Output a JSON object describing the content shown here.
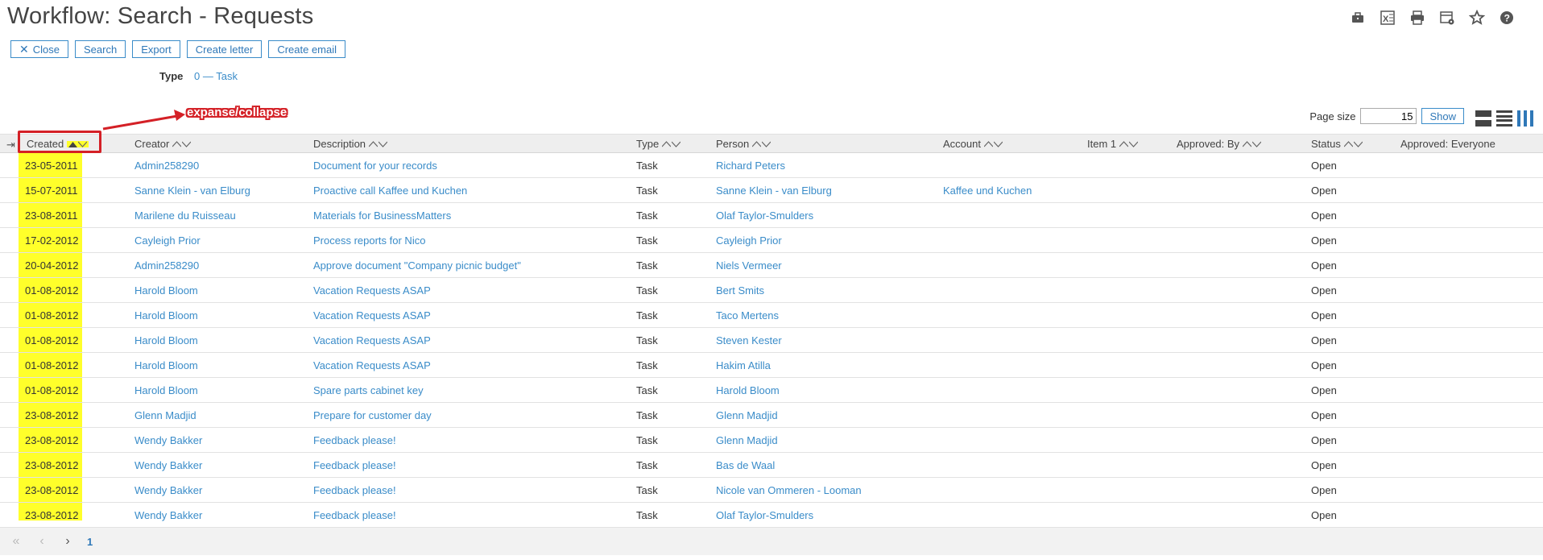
{
  "title": "Workflow: Search - Requests",
  "top_icons": [
    "briefcase-icon",
    "excel-icon",
    "print-icon",
    "calendar-settings-icon",
    "star-icon",
    "help-icon"
  ],
  "toolbar": {
    "close": "Close",
    "search": "Search",
    "export": "Export",
    "create_letter": "Create letter",
    "create_email": "Create email"
  },
  "filter": {
    "label": "Type",
    "value": "0 — Task"
  },
  "annotation": "expanse/collapse",
  "page_size": {
    "label": "Page size",
    "value": "15",
    "show": "Show"
  },
  "columns": {
    "created": "Created",
    "creator": "Creator",
    "description": "Description",
    "type": "Type",
    "person": "Person",
    "account": "Account",
    "item1": "Item 1",
    "approved_by": "Approved: By",
    "status": "Status",
    "approved_everyone": "Approved: Everyone"
  },
  "rows": [
    {
      "created": "23-05-2011",
      "creator": "Admin258290",
      "description": "Document for your records",
      "type": "Task",
      "person": "Richard Peters",
      "account": "",
      "status": "Open"
    },
    {
      "created": "15-07-2011",
      "creator": "Sanne Klein - van Elburg",
      "description": "Proactive call Kaffee und Kuchen",
      "type": "Task",
      "person": "Sanne Klein - van Elburg",
      "account": "Kaffee und Kuchen",
      "status": "Open"
    },
    {
      "created": "23-08-2011",
      "creator": "Marilene du Ruisseau",
      "description": "Materials for BusinessMatters",
      "type": "Task",
      "person": "Olaf Taylor-Smulders",
      "account": "",
      "status": "Open"
    },
    {
      "created": "17-02-2012",
      "creator": "Cayleigh Prior",
      "description": "Process reports for Nico",
      "type": "Task",
      "person": "Cayleigh Prior",
      "account": "",
      "status": "Open"
    },
    {
      "created": "20-04-2012",
      "creator": "Admin258290",
      "description": "Approve document \"Company picnic budget\"",
      "type": "Task",
      "person": "Niels Vermeer",
      "account": "",
      "status": "Open"
    },
    {
      "created": "01-08-2012",
      "creator": "Harold Bloom",
      "description": "Vacation Requests ASAP",
      "type": "Task",
      "person": "Bert Smits",
      "account": "",
      "status": "Open"
    },
    {
      "created": "01-08-2012",
      "creator": "Harold Bloom",
      "description": "Vacation Requests ASAP",
      "type": "Task",
      "person": "Taco Mertens",
      "account": "",
      "status": "Open"
    },
    {
      "created": "01-08-2012",
      "creator": "Harold Bloom",
      "description": "Vacation Requests ASAP",
      "type": "Task",
      "person": "Steven Kester",
      "account": "",
      "status": "Open"
    },
    {
      "created": "01-08-2012",
      "creator": "Harold Bloom",
      "description": "Vacation Requests ASAP",
      "type": "Task",
      "person": "Hakim Atilla",
      "account": "",
      "status": "Open"
    },
    {
      "created": "01-08-2012",
      "creator": "Harold Bloom",
      "description": "Spare parts cabinet key",
      "type": "Task",
      "person": "Harold Bloom",
      "account": "",
      "status": "Open"
    },
    {
      "created": "23-08-2012",
      "creator": "Glenn Madjid",
      "description": "Prepare for customer day",
      "type": "Task",
      "person": "Glenn Madjid",
      "account": "",
      "status": "Open"
    },
    {
      "created": "23-08-2012",
      "creator": "Wendy Bakker",
      "description": "Feedback please!",
      "type": "Task",
      "person": "Glenn Madjid",
      "account": "",
      "status": "Open"
    },
    {
      "created": "23-08-2012",
      "creator": "Wendy Bakker",
      "description": "Feedback please!",
      "type": "Task",
      "person": "Bas de Waal",
      "account": "",
      "status": "Open"
    },
    {
      "created": "23-08-2012",
      "creator": "Wendy Bakker",
      "description": "Feedback please!",
      "type": "Task",
      "person": "Nicole van Ommeren - Looman",
      "account": "",
      "status": "Open"
    },
    {
      "created": "23-08-2012",
      "creator": "Wendy Bakker",
      "description": "Feedback please!",
      "type": "Task",
      "person": "Olaf Taylor-Smulders",
      "account": "",
      "status": "Open"
    }
  ],
  "pager": {
    "current_page": "1"
  }
}
